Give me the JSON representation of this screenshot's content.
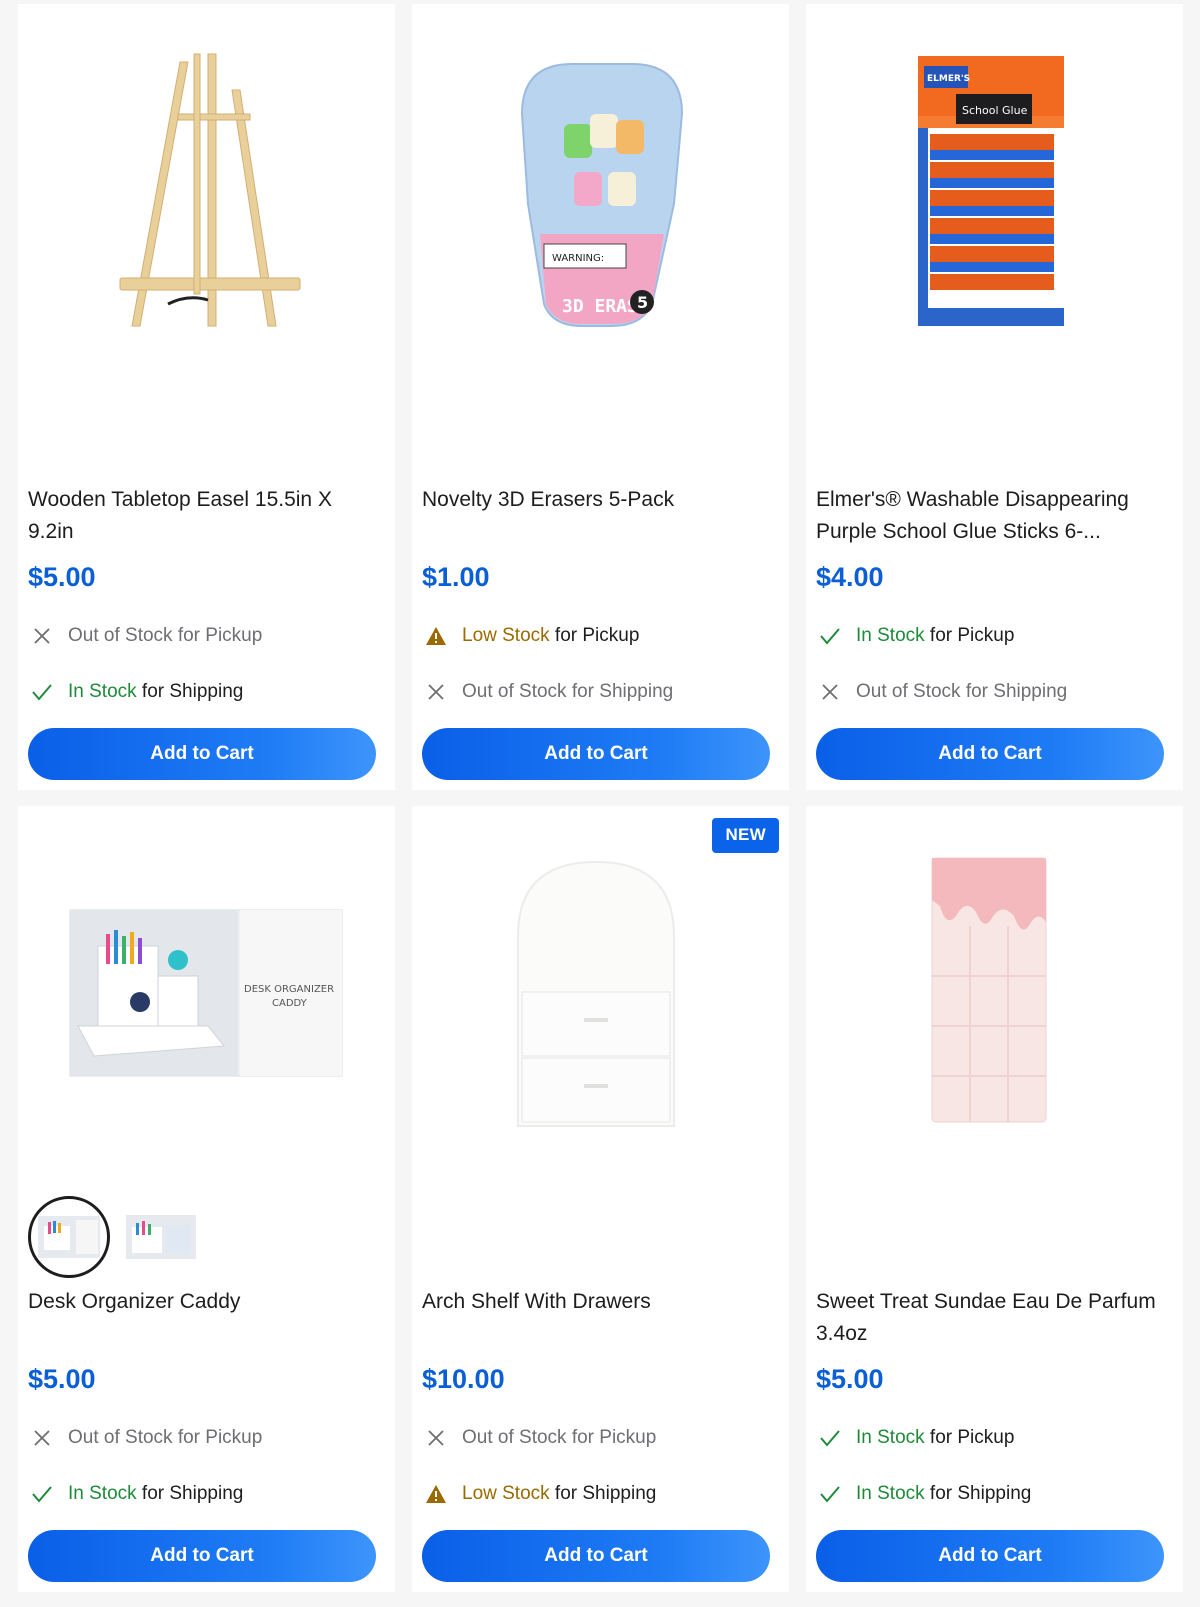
{
  "products": [
    {
      "title": "Wooden Tabletop Easel 15.5in X 9.2in",
      "price": "$5.00",
      "pickup": {
        "status": "Out of Stock for Pickup",
        "state": "out"
      },
      "shipping": {
        "status_strong": "In Stock",
        "status_rest": " for Shipping",
        "state": "in"
      },
      "button": "Add to Cart"
    },
    {
      "title": "Novelty 3D Erasers 5-Pack",
      "price": "$1.00",
      "pickup": {
        "status_strong": "Low Stock",
        "status_rest": " for Pickup",
        "state": "low"
      },
      "shipping": {
        "status": "Out of Stock for Shipping",
        "state": "out"
      },
      "button": "Add to Cart",
      "package_warning": "WARNING:",
      "package_label": "3D ERASERS",
      "package_count": "5"
    },
    {
      "title": "Elmer's® Washable Disappearing Purple School Glue Sticks 6-...",
      "price": "$4.00",
      "pickup": {
        "status_strong": "In Stock",
        "status_rest": " for Pickup",
        "state": "in"
      },
      "shipping": {
        "status": "Out of Stock for Shipping",
        "state": "out"
      },
      "button": "Add to Cart",
      "package_brand": "ELMER'S",
      "package_label": "School Glue"
    },
    {
      "title": "Desk Organizer Caddy",
      "price": "$5.00",
      "pickup": {
        "status": "Out of Stock for Pickup",
        "state": "out"
      },
      "shipping": {
        "status_strong": "In Stock",
        "status_rest": " for Shipping",
        "state": "in"
      },
      "button": "Add to Cart",
      "package_label_line1": "DESK ORGANIZER",
      "package_label_line2": "CADDY"
    },
    {
      "title": "Arch Shelf With Drawers",
      "price": "$10.00",
      "badge": "NEW",
      "pickup": {
        "status": "Out of Stock for Pickup",
        "state": "out"
      },
      "shipping": {
        "status_strong": "Low Stock",
        "status_rest": " for Shipping",
        "state": "low"
      },
      "button": "Add to Cart"
    },
    {
      "title": "Sweet Treat Sundae Eau De Parfum 3.4oz",
      "price": "$5.00",
      "pickup": {
        "status_strong": "In Stock",
        "status_rest": " for Pickup",
        "state": "in"
      },
      "shipping": {
        "status_strong": "In Stock",
        "status_rest": " for Shipping",
        "state": "in"
      },
      "button": "Add to Cart"
    }
  ],
  "colors": {
    "accent": "#0b5fd6",
    "button": "#1f7cf5",
    "in_stock": "#1e8a3a",
    "low_stock": "#9a6a00",
    "out_of_stock": "#6e6e73"
  }
}
